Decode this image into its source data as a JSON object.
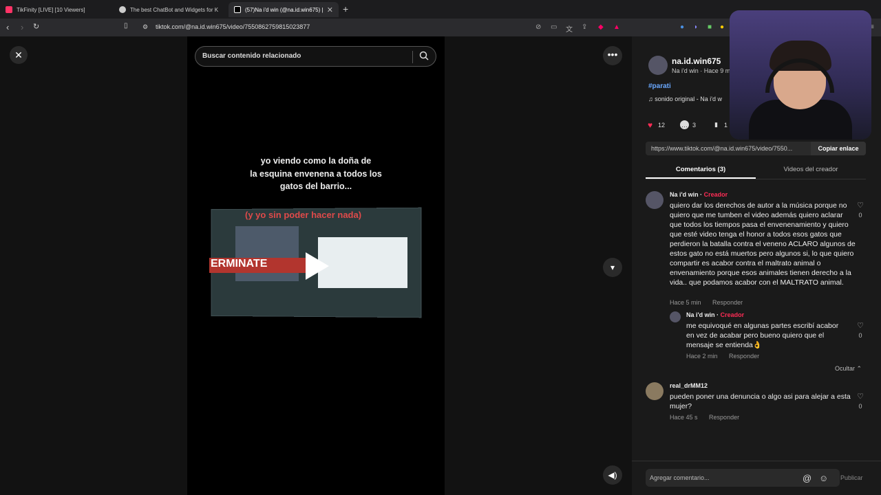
{
  "browser": {
    "tabs": [
      {
        "label": "TikFinity [LIVE] [10 Viewers]",
        "color": "#ff3366"
      },
      {
        "label": "The best ChatBot and Widgets for K",
        "color": "#cccccc"
      },
      {
        "label": "(57)Na i'd win (@na.id.win675) |",
        "color": "#ffffff"
      }
    ],
    "url": "tiktok.com/@na.id.win675/video/7550862759815023877"
  },
  "search": {
    "placeholder": "Buscar contenido relacionado"
  },
  "video": {
    "caption_lines": [
      "yo viendo como la doña de",
      "la esquina envenena a todos los",
      "gatos del barrio..."
    ],
    "overlay_text": "(y yo sin poder hacer nada)",
    "thumb_red_text": "ERMINATE"
  },
  "creator": {
    "username": "na.id.win675",
    "subtitle": "Na i'd win · Hace 9 m",
    "hashtag": "#parati",
    "music": "♫  sonido original - Na i'd w"
  },
  "actions": {
    "likes": "12",
    "comments": "3",
    "saves": "1"
  },
  "link": {
    "url": "https://www.tiktok.com/@na.id.win675/video/7550...",
    "copy_label": "Copiar enlace"
  },
  "tabs": {
    "comments": "Comentarios (3)",
    "creator_videos": "Videos del creador"
  },
  "comments": [
    {
      "author": "Na i'd win",
      "badge": "Creador",
      "text": "quiero dar los derechos de autor a la música porque no quiero que me tumben el video además quiero aclarar que todos los tiempos pasa el envenenamiento y quiero que esté video tenga el honor a todos esos gatos que perdieron la batalla contra el veneno ACLARO algunos de estos gato no está muertos pero algunos si, lo que quiero compartir es acabor contra el maltrato animal o envenamiento porque esos animales tienen derecho a la vida.. que podamos acabor con el MALTRATO animal.",
      "time": "Hace 5 min",
      "reply": "Responder",
      "likes": "0"
    },
    {
      "author": "Na i'd win",
      "badge": "Creador",
      "text": "me equivoqué en algunas partes escribí acabor en vez de acabar pero bueno quiero que el mensaje se entienda👌",
      "time": "Hace 2 min",
      "reply": "Responder",
      "likes": "0"
    },
    {
      "author": "real_drMM12",
      "badge": "",
      "text": "pueden poner una denuncia o algo asi para alejar a esta mujer?",
      "time": "Hace 45 s",
      "reply": "Responder",
      "likes": "0"
    }
  ],
  "hide_label": "Ocultar",
  "footer": {
    "placeholder": "Agregar comentario...",
    "publish": "Publicar"
  },
  "colors": {
    "accent": "#fe2c55",
    "hashtag": "#6aa8ff"
  }
}
